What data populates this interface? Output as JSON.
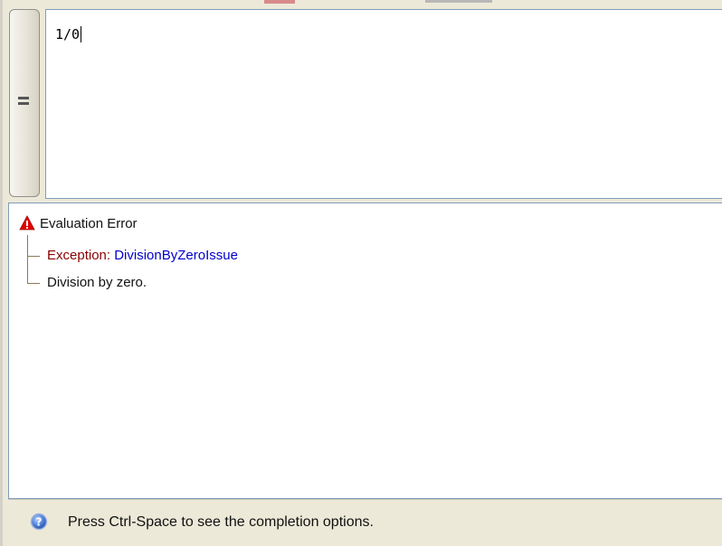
{
  "editor": {
    "code": "1/0"
  },
  "eval_button": {
    "icon": "equals-icon"
  },
  "result": {
    "root_label": "Evaluation Error",
    "root_icon": "warning-icon",
    "exception_label": "Exception:",
    "exception_type": "DivisionByZeroIssue",
    "message": "Division by zero."
  },
  "status": {
    "icon": "help-icon",
    "text": "Press Ctrl-Space to see the completion options."
  },
  "colors": {
    "window_bg": "#ece9d8",
    "border": "#7f9db9",
    "exception_label": "#8b0000",
    "exception_type": "#0000cc",
    "warning": "#e00000"
  }
}
